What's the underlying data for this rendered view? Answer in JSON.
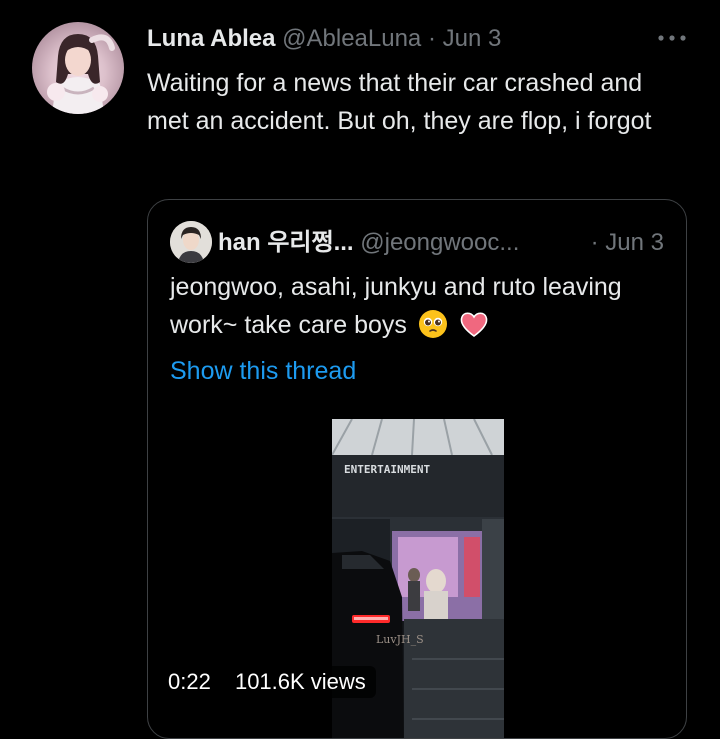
{
  "tweet": {
    "author_name": "Luna Ablea",
    "author_handle": "@AbleaLuna",
    "separator": "·",
    "date": "Jun 3",
    "more_icon": "more-horizontal-icon",
    "text": "Waiting for a news that their car crashed and met an accident. But oh, they are flop, i forgot"
  },
  "quote": {
    "author_name": "han 우리쩡...",
    "author_handle": "@jeongwooc...",
    "separator": "·",
    "date": "Jun 3",
    "text": "jeongwoo, asahi, junkyu and ruto leaving work~ take care boys",
    "emojis": [
      "pleading-face-icon",
      "heart-icon"
    ],
    "show_thread": "Show this thread",
    "media": {
      "type": "video",
      "sign_text": "ENTERTAINMENT",
      "watermark": "LuvJH_S",
      "duration": "0:22",
      "views": "101.6K views"
    }
  },
  "colors": {
    "background": "#000000",
    "text": "#e7e9ea",
    "secondary": "#71767b",
    "link": "#1d9bf0",
    "border": "#3e4144"
  }
}
